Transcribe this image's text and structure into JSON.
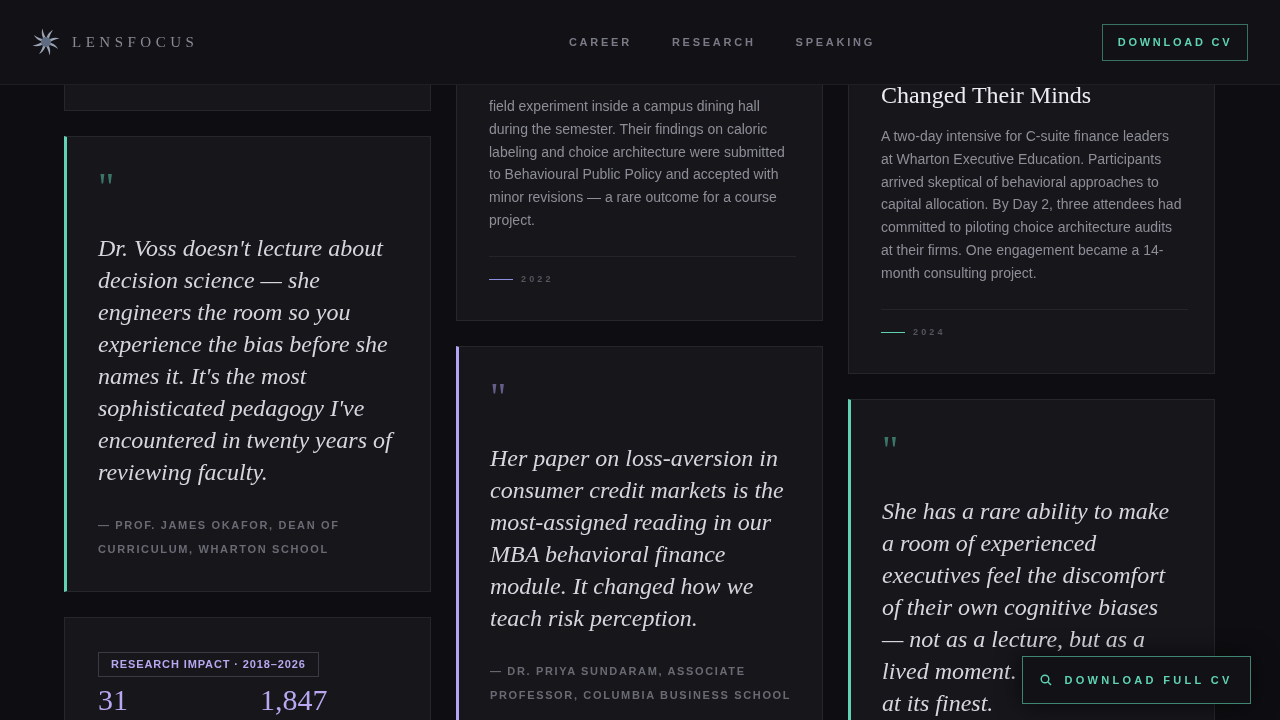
{
  "header": {
    "logo": "LENSFOCUS",
    "nav": [
      {
        "label": "CAREER"
      },
      {
        "label": "RESEARCH"
      },
      {
        "label": "SPEAKING"
      }
    ],
    "cta": "DOWNLOAD CV"
  },
  "columns": [
    [
      {
        "kind": "blank"
      },
      {
        "kind": "quote",
        "color": "#5fd3b3",
        "mark": "\"",
        "text": "Dr. Voss doesn't lecture about decision science — she engineers the room so you experience the bias before she names it. It's the most sophisticated pedagogy I've encountered in twenty years of reviewing faculty.",
        "attribution": "— PROF. JAMES OKAFOR, DEAN OF CURRICULUM, WHARTON SCHOOL"
      },
      {
        "kind": "stats",
        "badge": "RESEARCH IMPACT · 2018–2026",
        "stats": [
          {
            "value": "31"
          },
          {
            "value": "1,847"
          }
        ]
      }
    ],
    [
      {
        "kind": "project",
        "color": "#8b8fe0",
        "body": "field experiment inside a campus dining hall during the semester. Their findings on caloric labeling and choice architecture were submitted to Behavioural Public Policy and accepted with minor revisions — a rare outcome for a course project.",
        "year": "2022"
      },
      {
        "kind": "quote",
        "color": "#b5a3f5",
        "mark": "\"",
        "text": "Her paper on loss-aversion in consumer credit markets is the most-assigned reading in our MBA behavioral finance module. It changed how we teach risk perception.",
        "attribution": "— DR. PRIYA SUNDARAM, ASSOCIATE PROFESSOR, COLUMBIA BUSINESS SCHOOL"
      }
    ],
    [
      {
        "kind": "project",
        "color": "#5fd3b3",
        "title": "Changed Their Minds",
        "body": "A two-day intensive for C-suite finance leaders at Wharton Executive Education. Participants arrived skeptical of behavioral approaches to capital allocation. By Day 2, three attendees had committed to piloting choice architecture audits at their firms. One engagement became a 14-month consulting project.",
        "year": "2024"
      },
      {
        "kind": "quote",
        "color": "#5fd3b3",
        "mark": "\"",
        "text": "She has a rare ability to make a room of experienced executives feel the discomfort of their own cognitive biases — not as a lecture, but as a",
        "text_2": "lived moment.",
        "text_end": "at its finest."
      }
    ]
  ],
  "floating_button": {
    "label": "DOWNLOAD FULL CV"
  }
}
